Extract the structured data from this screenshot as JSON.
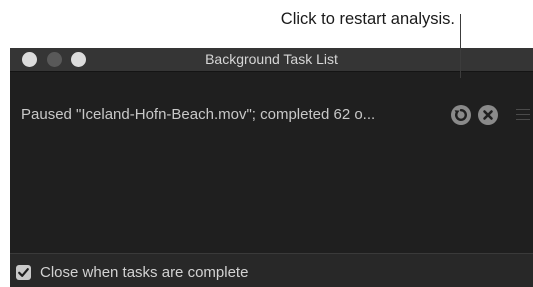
{
  "callout": {
    "text": "Click to restart analysis."
  },
  "window": {
    "title": "Background Task List"
  },
  "task": {
    "status_text": "Paused \"Iceland-Hofn-Beach.mov\"; completed 62 o...",
    "restart_icon": "restart-icon",
    "stop_icon": "stop-icon"
  },
  "footer": {
    "checkbox_checked": true,
    "checkbox_label": "Close when tasks are complete"
  },
  "colors": {
    "window_bg": "#1f1f1f",
    "titlebar_bg": "#353535",
    "button_gray": "#8a8a8a"
  }
}
